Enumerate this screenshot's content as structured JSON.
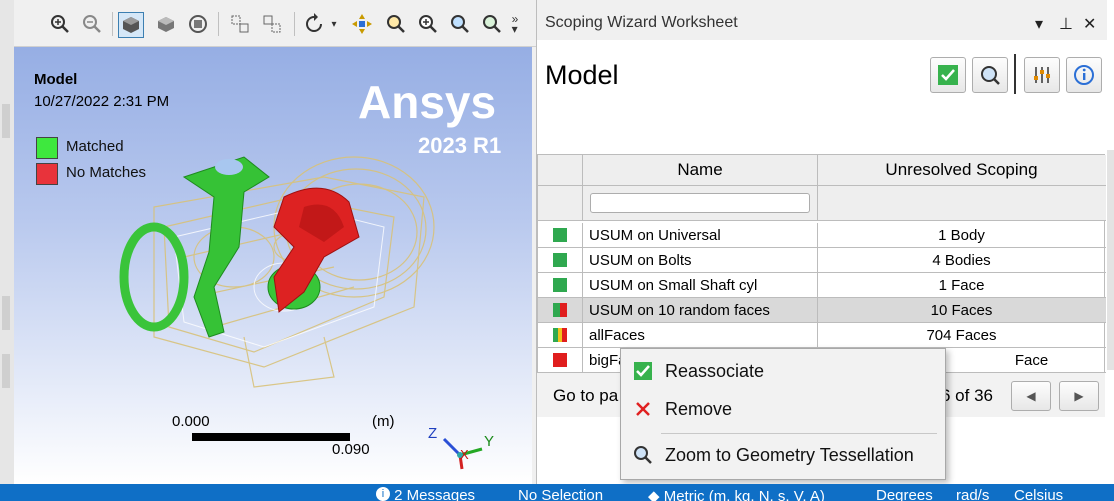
{
  "toolbar": {
    "icons": [
      "zoom-in-icon",
      "zoom-out-icon",
      "iso-view-icon",
      "solid-view-icon",
      "wireframe-icon",
      "select-icon",
      "box-select-icon",
      "rotate-icon",
      "pan-icon",
      "zoom-box-icon",
      "zoom-fit-icon",
      "zoom-region-icon",
      "zoom-next-icon",
      "overflow-icon"
    ]
  },
  "viewport": {
    "title": "Model",
    "date": "10/27/2022 2:31 PM",
    "legend": [
      {
        "label": "Matched",
        "color": "#3ee83e"
      },
      {
        "label": "No Matches",
        "color": "#e8333b"
      }
    ],
    "logo": "Ansys",
    "version": "2023 R1",
    "scale": {
      "left": "0.000",
      "right": "0.090",
      "unit": "(m)"
    },
    "triad": {
      "z": "Z",
      "y": "Y",
      "x": "X"
    }
  },
  "panel": {
    "title": "Scoping Wizard Worksheet",
    "controls": {
      "menu": "▾",
      "pin": "⊥",
      "close": "✕"
    },
    "heading": "Model",
    "table": {
      "columns": [
        "Name",
        "Unresolved Scoping"
      ],
      "filter_placeholder": "",
      "rows": [
        {
          "name": "USUM on Universal",
          "scoping": "1 Body",
          "status": "matched"
        },
        {
          "name": "USUM on Bolts",
          "scoping": "4 Bodies",
          "status": "matched"
        },
        {
          "name": "USUM on Small Shaft cyl",
          "scoping": "1 Face",
          "status": "matched"
        },
        {
          "name": "USUM on 10 random faces",
          "scoping": "10 Faces",
          "status": "partial-gr",
          "selected": true
        },
        {
          "name": "allFaces",
          "scoping": "704 Faces",
          "status": "partial-gyr"
        },
        {
          "name": "bigFa",
          "scoping": "Face",
          "status": "nomatch"
        }
      ]
    },
    "pager": {
      "goto": "Go to pa",
      "count": "6 of 36",
      "prev": "◀",
      "next": "▶"
    }
  },
  "context_menu": {
    "items": [
      {
        "label": "Reassociate",
        "icon": "checkmark-icon"
      },
      {
        "label": "Remove",
        "icon": "red-x-icon"
      },
      {
        "label": "Zoom to Geometry Tessellation",
        "icon": "zoom-geometry-icon"
      }
    ]
  },
  "status_bar": {
    "messages": "2 Messages",
    "selection": "No Selection",
    "units": "Metric (m, kg, N, s, V, A)",
    "angle": "Degrees",
    "rotational": "rad/s",
    "temperature": "Celsius"
  },
  "colors": {
    "matched": "#2fa84f",
    "nomatch": "#e01e1e",
    "partial_yellow": "#f1c21b",
    "status_bar": "#0f6fc6"
  }
}
